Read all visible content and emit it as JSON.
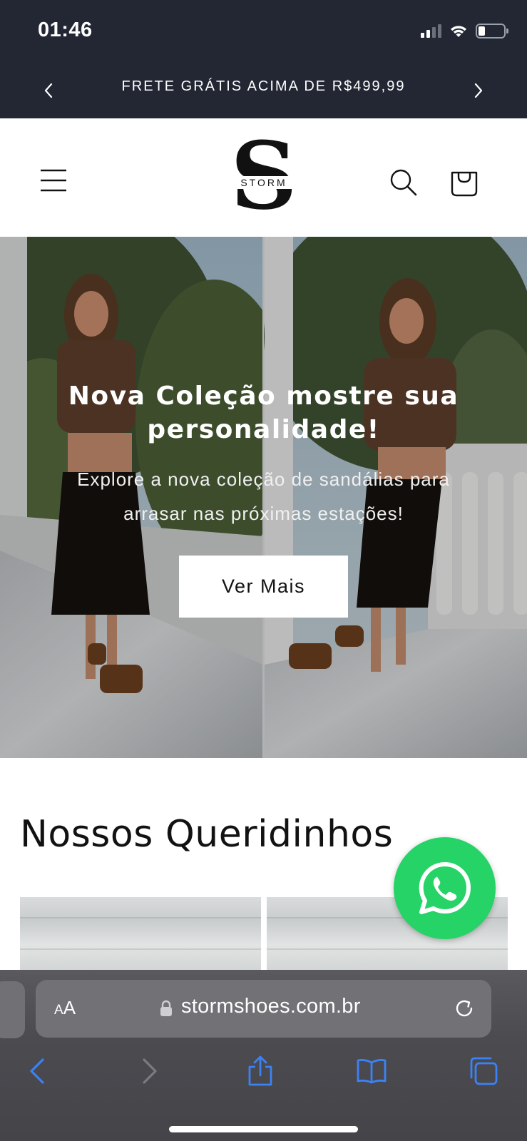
{
  "status_bar": {
    "time": "01:46"
  },
  "announcement": {
    "text": "FRETE GRÁTIS ACIMA DE R$499,99"
  },
  "header": {
    "logo_letter": "S",
    "logo_text": "STORM"
  },
  "hero": {
    "title": "Nova Coleção mostre sua personalidade!",
    "subtitle": "Explore a nova coleção de sandálias para arrasar nas próximas estações!",
    "button_label": "Ver Mais"
  },
  "section": {
    "title": "Nossos Queridinhos"
  },
  "browser": {
    "aa_small": "A",
    "aa_large": "A",
    "url": "stormshoes.com.br",
    "accent_color": "#3b82f6"
  },
  "colors": {
    "announcement_bg": "#222733",
    "whatsapp_green": "#25d366",
    "text_dark": "#121212"
  }
}
